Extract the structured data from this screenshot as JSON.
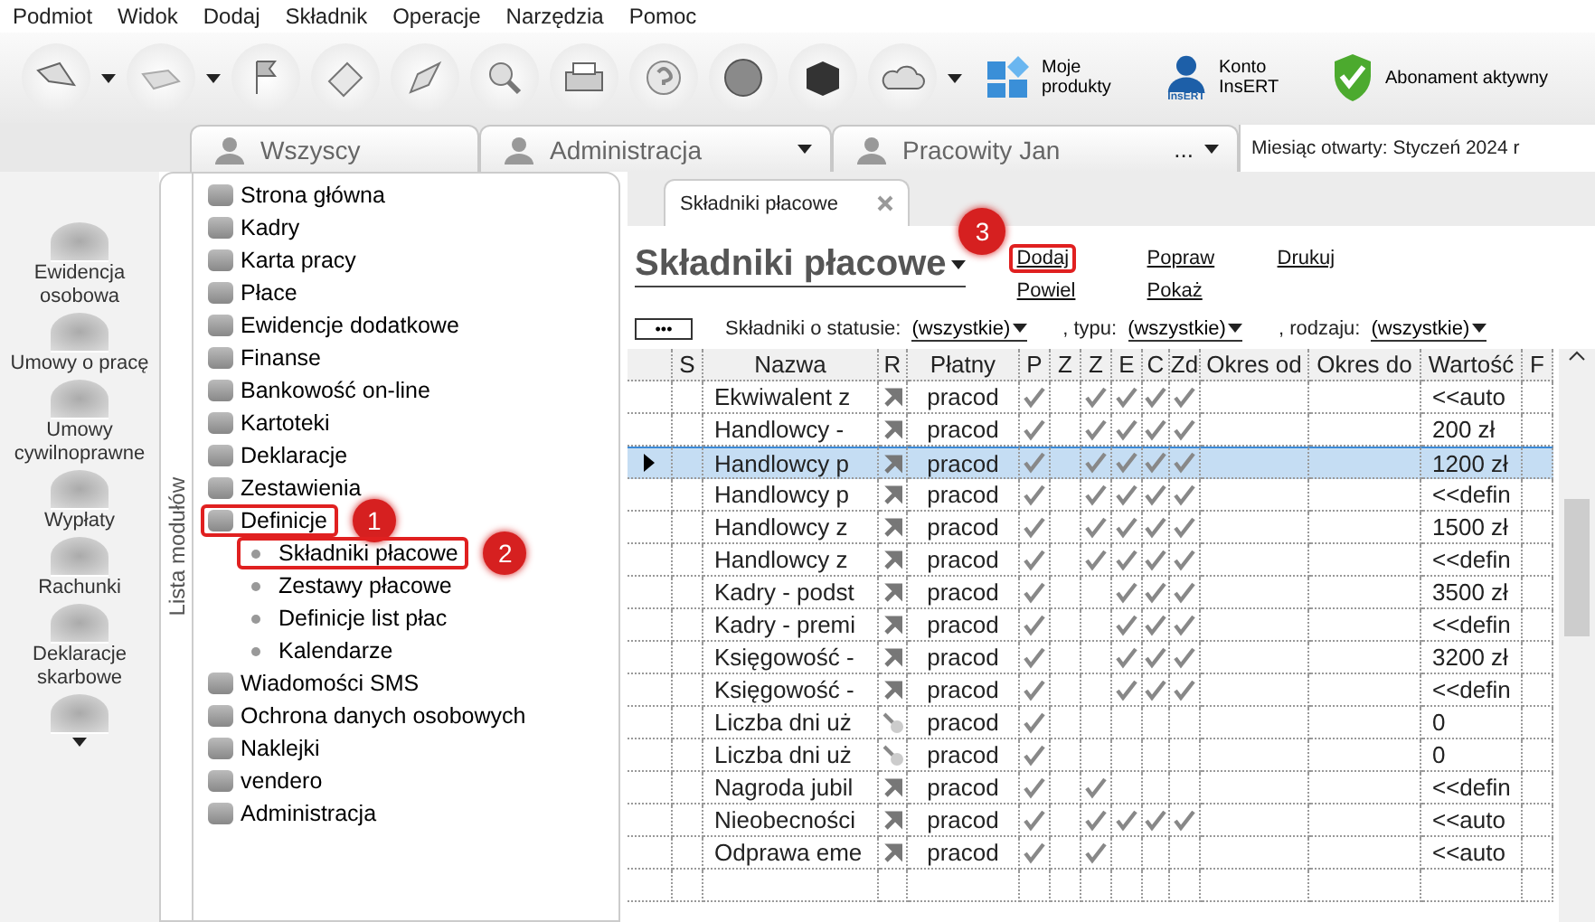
{
  "menu": [
    "Podmiot",
    "Widok",
    "Dodaj",
    "Składnik",
    "Operacje",
    "Narzędzia",
    "Pomoc"
  ],
  "toolbar": {
    "products": "Moje produkty",
    "account": "Konto InsERT",
    "account_badge": "InsERT",
    "subscription": "Abonament aktywny"
  },
  "context_tabs": [
    {
      "label": "Wszyscy"
    },
    {
      "label": "Administracja"
    },
    {
      "label": "Pracowity Jan",
      "more": "..."
    }
  ],
  "open_month": {
    "label": "Miesiąc otwarty:",
    "value": "Styczeń 2024 r"
  },
  "rail": [
    "Ewidencja osobowa",
    "Umowy o pracę",
    "Umowy cywilnoprawne",
    "Wypłaty",
    "Rachunki",
    "Deklaracje skarbowe"
  ],
  "modules": {
    "title": "Lista modułów",
    "items": [
      {
        "label": "Strona główna",
        "selected": false
      },
      {
        "label": "Kadry",
        "selected": false
      },
      {
        "label": "Karta pracy",
        "selected": false
      },
      {
        "label": "Płace",
        "selected": false
      },
      {
        "label": "Ewidencje dodatkowe",
        "selected": false
      },
      {
        "label": "Finanse",
        "selected": false
      },
      {
        "label": "Bankowość on-line",
        "selected": false
      },
      {
        "label": "Kartoteki",
        "selected": false
      },
      {
        "label": "Deklaracje",
        "selected": false
      },
      {
        "label": "Zestawienia",
        "selected": false
      },
      {
        "label": "Definicje",
        "selected": true,
        "callout": "1",
        "children": [
          {
            "label": "Składniki płacowe",
            "selected": true,
            "callout": "2"
          },
          {
            "label": "Zestawy płacowe",
            "selected": false
          },
          {
            "label": "Definicje list płac",
            "selected": false
          },
          {
            "label": "Kalendarze",
            "selected": false
          }
        ]
      },
      {
        "label": "Wiadomości SMS",
        "selected": false
      },
      {
        "label": "Ochrona danych osobowych",
        "selected": false
      },
      {
        "label": "Naklejki",
        "selected": false
      },
      {
        "label": "vendero",
        "selected": false
      },
      {
        "label": "Administracja",
        "selected": false
      }
    ]
  },
  "document_tab": "Składniki płacowe",
  "heading": "Składniki płacowe",
  "actions": [
    {
      "label": "Dodaj",
      "callout": "3"
    },
    {
      "label": "Popraw"
    },
    {
      "label": "Drukuj"
    },
    {
      "label": "Powiel"
    },
    {
      "label": "Pokaż"
    }
  ],
  "filters": {
    "more": "•••",
    "items": [
      {
        "label": "Składniki o statusie:",
        "value": "(wszystkie)"
      },
      {
        "label": ", typu:",
        "value": "(wszystkie)"
      },
      {
        "label": ", rodzaju:",
        "value": "(wszystkie)"
      }
    ]
  },
  "table": {
    "columns": [
      "S",
      "Nazwa",
      "R",
      "Płatny",
      "P",
      "Z",
      "Z",
      "E",
      "C",
      "Zd",
      "Okres od",
      "Okres do",
      "Wartość",
      "F"
    ],
    "rows": [
      {
        "name": "Ekwiwalent z",
        "kind": "arrow",
        "payer": "pracod",
        "flags": [
          true,
          false,
          true,
          true,
          true,
          true
        ],
        "value": "<<auto",
        "selected": false
      },
      {
        "name": "Handlowcy -",
        "kind": "arrow",
        "payer": "pracod",
        "flags": [
          true,
          false,
          true,
          true,
          true,
          true
        ],
        "value": "200 zł",
        "selected": false
      },
      {
        "name": "Handlowcy p",
        "kind": "arrow",
        "payer": "pracod",
        "flags": [
          true,
          false,
          true,
          true,
          true,
          true
        ],
        "value": "1200 zł",
        "selected": true
      },
      {
        "name": "Handlowcy p",
        "kind": "arrow",
        "payer": "pracod",
        "flags": [
          true,
          false,
          true,
          true,
          true,
          true
        ],
        "value": "<<defin",
        "selected": false
      },
      {
        "name": "Handlowcy z",
        "kind": "arrow",
        "payer": "pracod",
        "flags": [
          true,
          false,
          true,
          true,
          true,
          true
        ],
        "value": "1500 zł",
        "selected": false
      },
      {
        "name": "Handlowcy z",
        "kind": "arrow",
        "payer": "pracod",
        "flags": [
          true,
          false,
          true,
          true,
          true,
          true
        ],
        "value": "<<defin",
        "selected": false
      },
      {
        "name": "Kadry - podst",
        "kind": "arrow",
        "payer": "pracod",
        "flags": [
          true,
          false,
          false,
          true,
          true,
          true
        ],
        "value": "3500 zł",
        "selected": false
      },
      {
        "name": "Kadry - premi",
        "kind": "arrow",
        "payer": "pracod",
        "flags": [
          true,
          false,
          false,
          true,
          true,
          true
        ],
        "value": "<<defin",
        "selected": false
      },
      {
        "name": "Księgowość -",
        "kind": "arrow",
        "payer": "pracod",
        "flags": [
          true,
          false,
          false,
          true,
          true,
          true
        ],
        "value": "3200 zł",
        "selected": false
      },
      {
        "name": "Księgowość -",
        "kind": "arrow",
        "payer": "pracod",
        "flags": [
          true,
          false,
          false,
          true,
          true,
          true
        ],
        "value": "<<defin",
        "selected": false
      },
      {
        "name": "Liczba dni uż",
        "kind": "dot",
        "payer": "pracod",
        "flags": [
          true,
          false,
          false,
          false,
          false,
          false
        ],
        "value": "0",
        "selected": false
      },
      {
        "name": "Liczba dni uż",
        "kind": "dot",
        "payer": "pracod",
        "flags": [
          true,
          false,
          false,
          false,
          false,
          false
        ],
        "value": "0",
        "selected": false
      },
      {
        "name": "Nagroda jubil",
        "kind": "arrow",
        "payer": "pracod",
        "flags": [
          true,
          false,
          true,
          false,
          false,
          false
        ],
        "value": "<<defin",
        "selected": false
      },
      {
        "name": "Nieobecności",
        "kind": "arrow",
        "payer": "pracod",
        "flags": [
          true,
          false,
          true,
          true,
          true,
          true
        ],
        "value": "<<auto",
        "selected": false
      },
      {
        "name": "Odprawa eme",
        "kind": "arrow",
        "payer": "pracod",
        "flags": [
          true,
          false,
          true,
          false,
          false,
          false
        ],
        "value": "<<auto",
        "selected": false
      }
    ]
  }
}
